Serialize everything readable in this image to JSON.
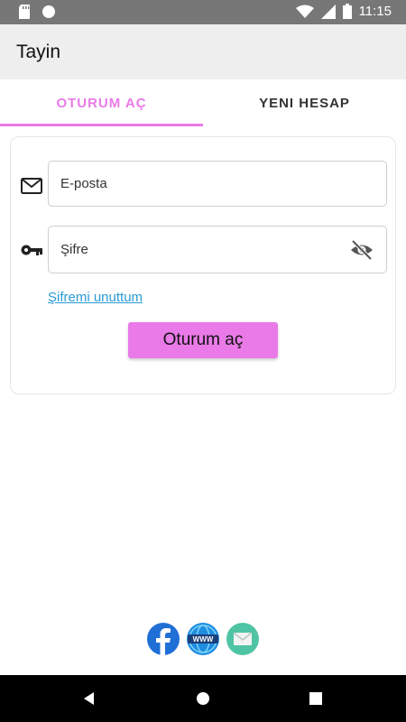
{
  "status_bar": {
    "time": "11:15",
    "icons": [
      "sd-card-icon",
      "circle-icon",
      "wifi-icon",
      "signal-icon",
      "battery-icon"
    ]
  },
  "app_bar": {
    "title": "Tayin"
  },
  "tabs": [
    {
      "label": "OTURUM AÇ",
      "active": true
    },
    {
      "label": "YENI HESAP",
      "active": false
    }
  ],
  "login_form": {
    "email_placeholder": "E-posta",
    "password_placeholder": "Şifre",
    "forgot_password": "Şifremi unuttum",
    "submit_label": "Oturum aç"
  },
  "social_links": [
    "facebook-icon",
    "www-icon",
    "mail-icon"
  ],
  "colors": {
    "accent": "#ea7ae8",
    "link": "#2a9ad6",
    "app_bar": "#eeeeee",
    "status_bar": "#777777"
  }
}
